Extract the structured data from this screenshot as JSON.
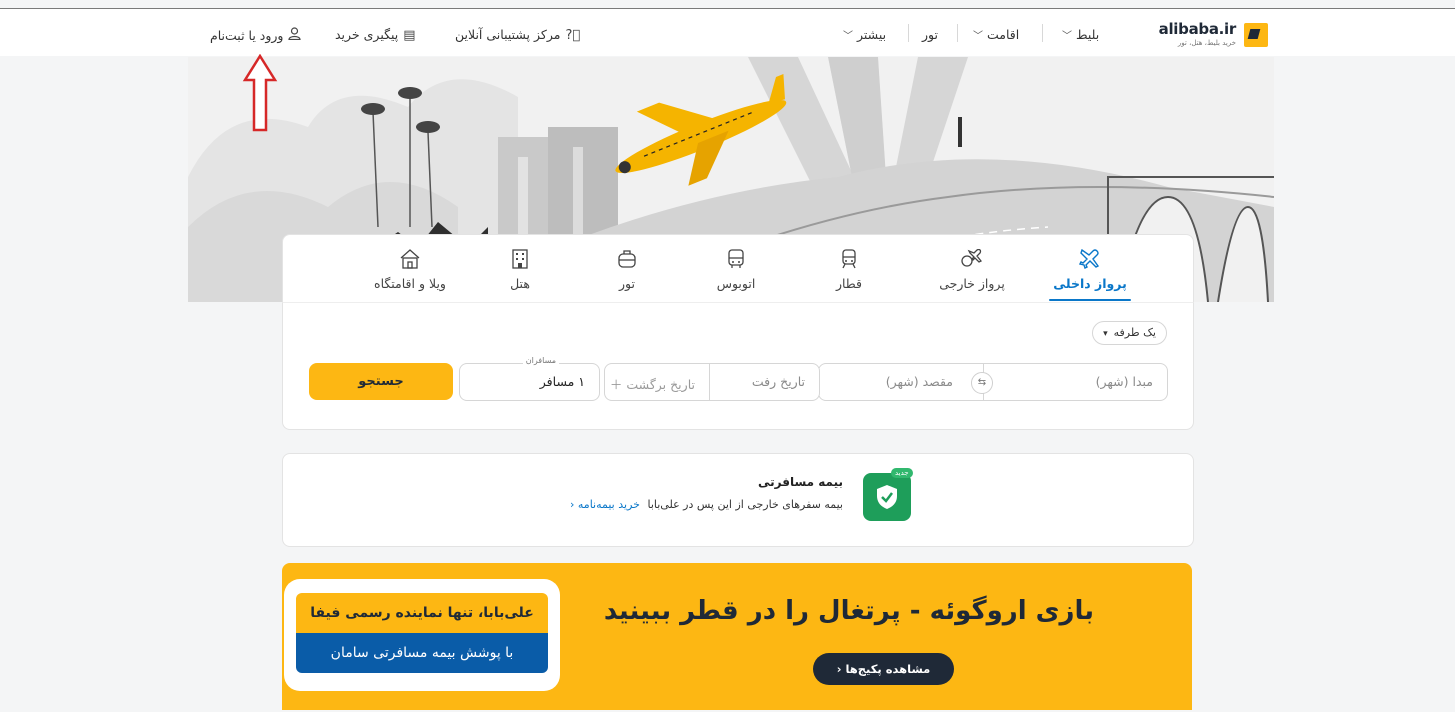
{
  "brand": {
    "name": "alibaba.ir",
    "tagline": "خرید بلیط، هتل، تور"
  },
  "nav": {
    "ticket": "بلیط",
    "stay": "اقامت",
    "tour": "تور",
    "more": "بیشتر"
  },
  "header_links": {
    "support": "مرکز پشتیبانی آنلاین",
    "track": "پیگیری خرید",
    "login": "ورود یا ثبت‌نام"
  },
  "tabs": [
    {
      "label": "پرواز داخلی",
      "icon": "plane-domestic-icon",
      "active": true
    },
    {
      "label": "پرواز خارجی",
      "icon": "plane-international-icon",
      "active": false
    },
    {
      "label": "قطار",
      "icon": "train-icon",
      "active": false
    },
    {
      "label": "اتوبوس",
      "icon": "bus-icon",
      "active": false
    },
    {
      "label": "تور",
      "icon": "tour-icon",
      "active": false
    },
    {
      "label": "هتل",
      "icon": "hotel-icon",
      "active": false
    },
    {
      "label": "ویلا و اقامتگاه",
      "icon": "villa-icon",
      "active": false
    }
  ],
  "search": {
    "trip_type": "یک طرفه",
    "origin_placeholder": "مبدا (شهر)",
    "destination_placeholder": "مقصد (شهر)",
    "depart_placeholder": "تاریخ رفت",
    "return_placeholder": "تاریخ برگشت",
    "passengers_label": "مسافران",
    "passengers_value": "۱ مسافر",
    "submit": "جستجو"
  },
  "insurance": {
    "badge": "جدید",
    "title": "بیمه مسافرتی",
    "description": "بیمه سفرهای خارجی از این پس در علی‌بابا",
    "link": "خرید بیمه‌نامه"
  },
  "promo": {
    "title": "بازی اروگوئه - پرتغال را در قطر ببینید",
    "button": "مشاهده پکیج‌ها",
    "box_line1": "علی‌بابا، تنها نماینده رسمی فیفا",
    "box_line2": "با پوشش بیمه مسافرتی سامان"
  },
  "colors": {
    "brand_yellow": "#fdb713",
    "accent_blue": "#0a77c9",
    "annotation_red": "#d62828"
  }
}
